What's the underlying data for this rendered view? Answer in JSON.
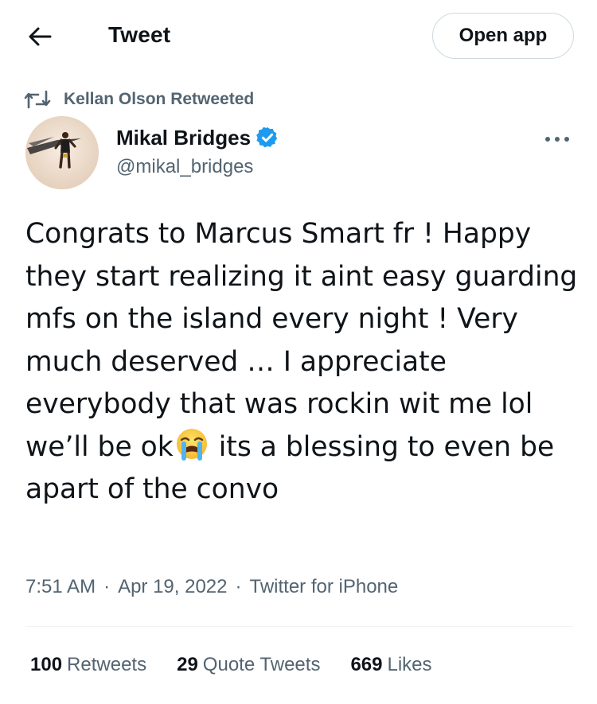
{
  "header": {
    "title": "Tweet",
    "open_app_label": "Open app",
    "back_icon": "arrow-left-icon"
  },
  "retweet_context": {
    "text": "Kellan Olson Retweeted",
    "icon": "retweet-icon"
  },
  "author": {
    "name": "Mikal Bridges",
    "handle": "@mikal_bridges",
    "verified": true,
    "verified_color": "#1d9bf0"
  },
  "tweet": {
    "text_before_emoji": "Congrats to Marcus Smart fr ! Happy they start realizing it aint easy guarding mfs on the island every night ! Very much deserved … I appreciate everybody that was rockin wit me lol we’ll be ok",
    "emoji": "loudly-crying-face",
    "text_after_emoji": " its a blessing to even be apart of the convo"
  },
  "meta": {
    "time": "7:51 AM",
    "date": "Apr 19, 2022",
    "source": "Twitter for iPhone",
    "separator": "·"
  },
  "stats": {
    "retweets_count": "100",
    "retweets_label": "Retweets",
    "quotes_count": "29",
    "quotes_label": "Quote Tweets",
    "likes_count": "669",
    "likes_label": "Likes"
  },
  "colors": {
    "text_primary": "#0f1419",
    "text_secondary": "#536471",
    "border": "#cfd9de",
    "divider": "#eff3f4"
  }
}
